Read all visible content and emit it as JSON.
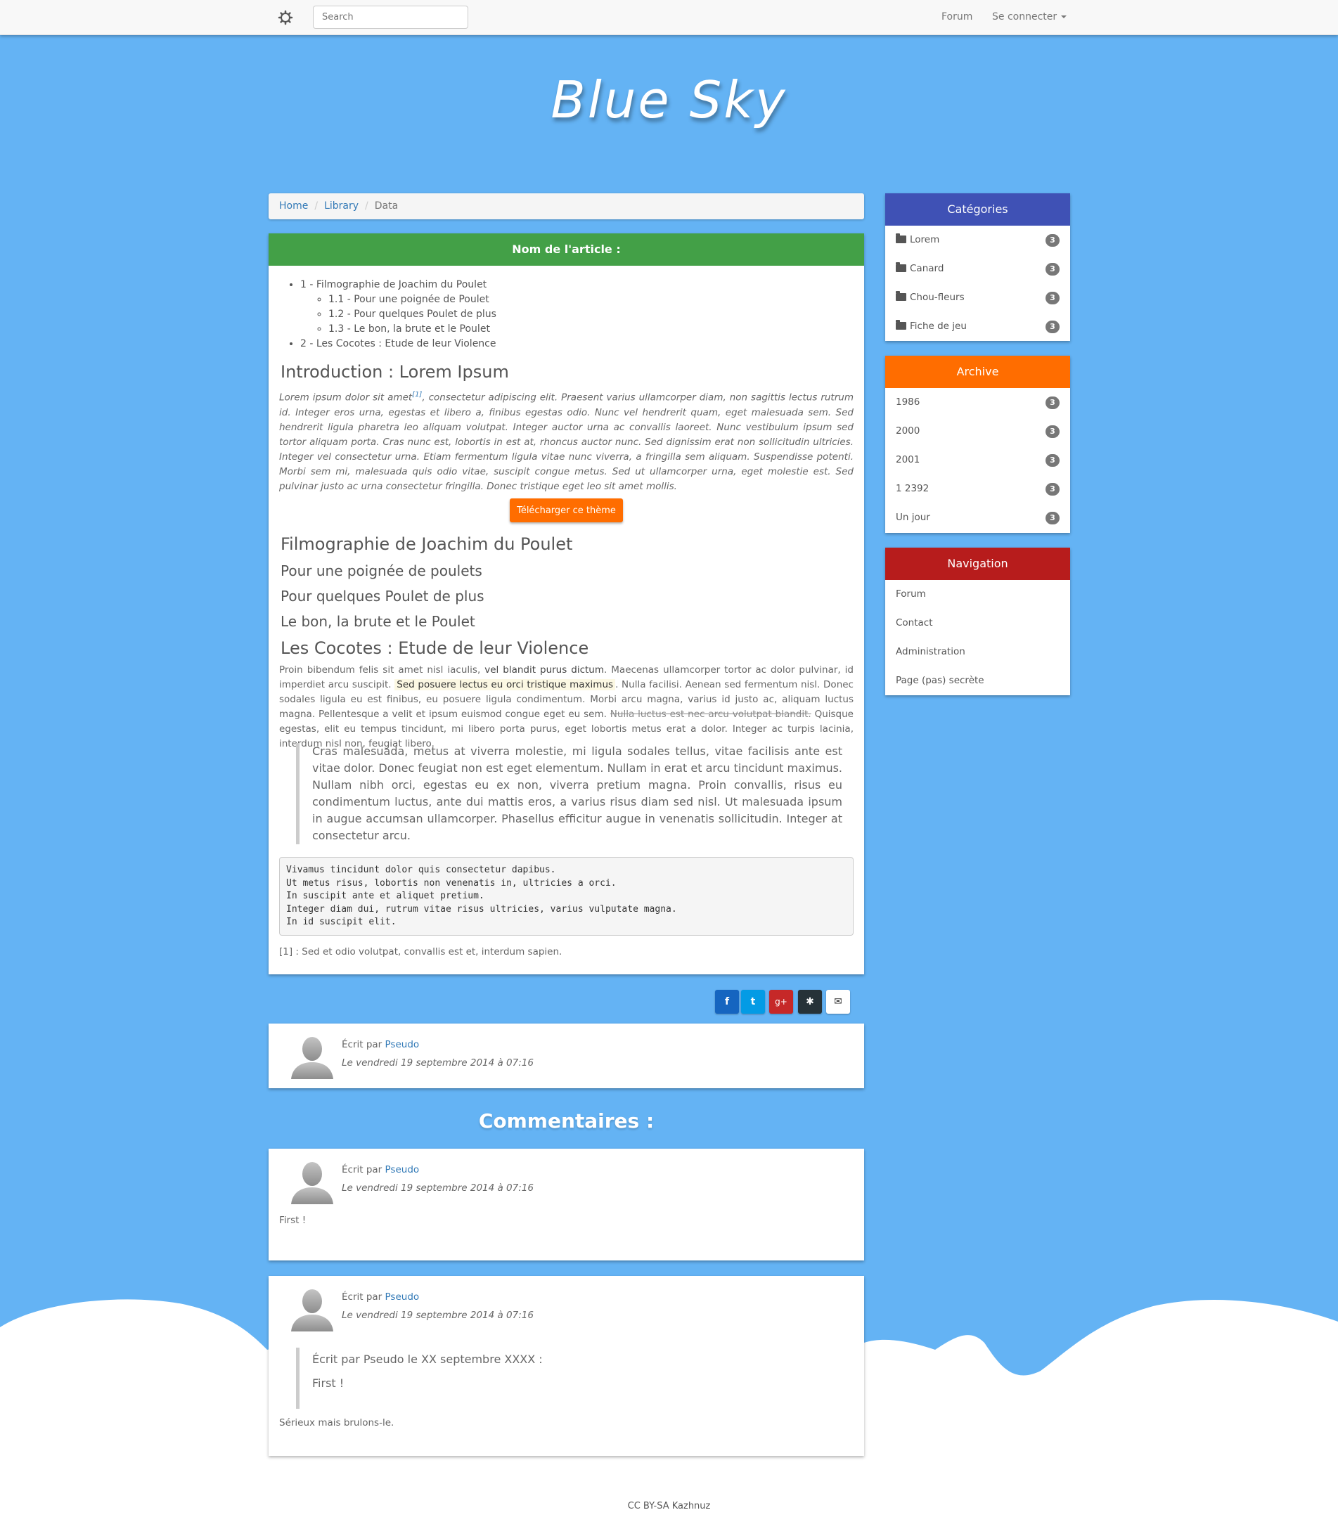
{
  "navbar": {
    "search_placeholder": "Search",
    "forum": "Forum",
    "login": "Se connecter"
  },
  "site_title": "Blue Sky",
  "breadcrumb": [
    "Home",
    "Library",
    "Data"
  ],
  "article": {
    "header": "Nom de l'article :",
    "toc": {
      "item1": "1 - Filmographie de Joachim du Poulet",
      "sub1": "1.1 - Pour une poignée de Poulet",
      "sub2": "1.2 - Pour quelques Poulet de plus",
      "sub3": "1.3 - Le bon, la brute et le Poulet",
      "item2": "2 - Les Cocotes : Etude de leur Violence"
    },
    "intro_title": "Introduction : Lorem Ipsum",
    "intro_text_a": "Lorem ipsum dolor sit amet",
    "intro_sup": "[1]",
    "intro_text_b": ", consectetur adipiscing elit. Praesent varius ullamcorper diam, non sagittis lectus rutrum id. Integer eros urna, egestas et libero a, finibus egestas odio. Nunc vel hendrerit quam, eget malesuada sem. Sed hendrerit ligula pharetra leo aliquam volutpat. Integer auctor urna ac convallis laoreet. Nunc vestibulum ipsum sed tortor aliquam porta. Cras nunc est, lobortis in est at, rhoncus auctor nunc. Sed dignissim erat non sollicitudin ultricies. Integer vel consectetur urna. Etiam fermentum ligula vitae nunc viverra, a fringilla sem aliquam. Suspendisse potenti. Morbi sem mi, malesuada quis odio vitae, suscipit congue metus. Sed ut ullamcorper urna, eget molestie est. Sed pulvinar justo ac urna consectetur fringilla. Donec tristique eget leo sit amet mollis.",
    "download_button": "Télécharger ce thème",
    "h_filmo": "Filmographie de Joachim du Poulet",
    "h_sub1": "Pour une poignée de poulets",
    "h_sub2": "Pour quelques Poulet de plus",
    "h_sub3": "Le bon, la brute et le Poulet",
    "h_cocotes": "Les Cocotes : Etude de leur Violence",
    "p_a": "Proin bibendum felis sit amet nisl iaculis, ",
    "p_strong": "vel blandit purus dictum",
    "p_b": ". Maecenas ullamcorper tortor ac dolor pulvinar, id imperdiet arcu suscipit. ",
    "p_mark": "Sed posuere lectus eu orci tristique maximus",
    "p_c": ". Nulla facilisi. Aenean sed fermentum nisl. Donec sodales ligula eu est finibus, eu posuere ligula condimentum. Morbi arcu magna, varius id justo ac, aliquam luctus magna. Pellentesque a velit et ipsum euismod congue eget eu sem. ",
    "p_del": "Nulla luctus est nec arcu volutpat blandit.",
    "p_d": " Quisque egestas, elit eu tempus tincidunt, mi libero porta purus, eget lobortis metus erat a dolor. Integer ac turpis lacinia, interdum nisl non, feugiat libero.",
    "quote": "Cras malesuada, metus at viverra molestie, mi ligula sodales tellus, vitae facilisis ante est vitae dolor. Donec feugiat non est eget elementum. Nullam in erat et arcu tincidunt maximus. Nullam nibh orci, egestas eu ex non, viverra pretium magna. Proin convallis, risus eu condimentum luctus, ante dui mattis eros, a varius risus diam sed nisl. Ut malesuada ipsum in augue accumsan ullamcorper. Phasellus efficitur augue in venenatis sollicitudin. Integer at consectetur arcu.",
    "code": "Vivamus tincidunt dolor quis consectetur dapibus.\nUt metus risus, lobortis non venenatis in, ultricies a orci.\nIn suscipit ante et aliquet pretium.\nInteger diam dui, rutrum vitae risus ultricies, varius vulputate magna.\nIn id suscipit elit.",
    "footnote": "[1] : Sed et odio volutpat, convallis est et, interdum sapien."
  },
  "share": {
    "facebook": "f",
    "twitter": "t",
    "gplus": "g+",
    "other": "✱",
    "email": "✉",
    "colors": {
      "facebook": "#1565c0",
      "twitter": "#039be5",
      "gplus": "#c62828",
      "other": "#263238",
      "email": "#ffffff"
    }
  },
  "author": {
    "written_by": "Écrit par ",
    "pseudo": "Pseudo",
    "date": "Le vendredi 19 septembre 2014 à 07:16"
  },
  "comments_title": "Commentaires :",
  "comments": [
    {
      "written_by": "Écrit par ",
      "pseudo": "Pseudo",
      "date": "Le vendredi 19 septembre 2014 à 07:16",
      "text": "First !"
    },
    {
      "written_by": "Écrit par ",
      "pseudo": "Pseudo",
      "date": "Le vendredi 19 septembre 2014 à 07:16",
      "quote_head": "Écrit par Pseudo le XX septembre XXXX :",
      "quote_text": "First !",
      "text": "Sérieux mais brulons-le."
    }
  ],
  "sidebar": {
    "categories": {
      "title": "Catégories",
      "color": "#3f51b5",
      "items": [
        {
          "label": "Lorem",
          "count": "3"
        },
        {
          "label": "Canard",
          "count": "3"
        },
        {
          "label": "Chou-fleurs",
          "count": "3"
        },
        {
          "label": "Fiche de jeu",
          "count": "3"
        }
      ]
    },
    "archive": {
      "title": "Archive",
      "color": "#ff6d00",
      "items": [
        {
          "label": "1986",
          "count": "3"
        },
        {
          "label": "2000",
          "count": "3"
        },
        {
          "label": "2001",
          "count": "3"
        },
        {
          "label": "1 2392",
          "count": "3"
        },
        {
          "label": "Un jour",
          "count": "3"
        }
      ]
    },
    "navigation": {
      "title": "Navigation",
      "color": "#b71c1c",
      "items": [
        "Forum",
        "Contact",
        "Administration",
        "Page (pas) secrète"
      ]
    }
  },
  "footer": "CC BY-SA Kazhnuz"
}
